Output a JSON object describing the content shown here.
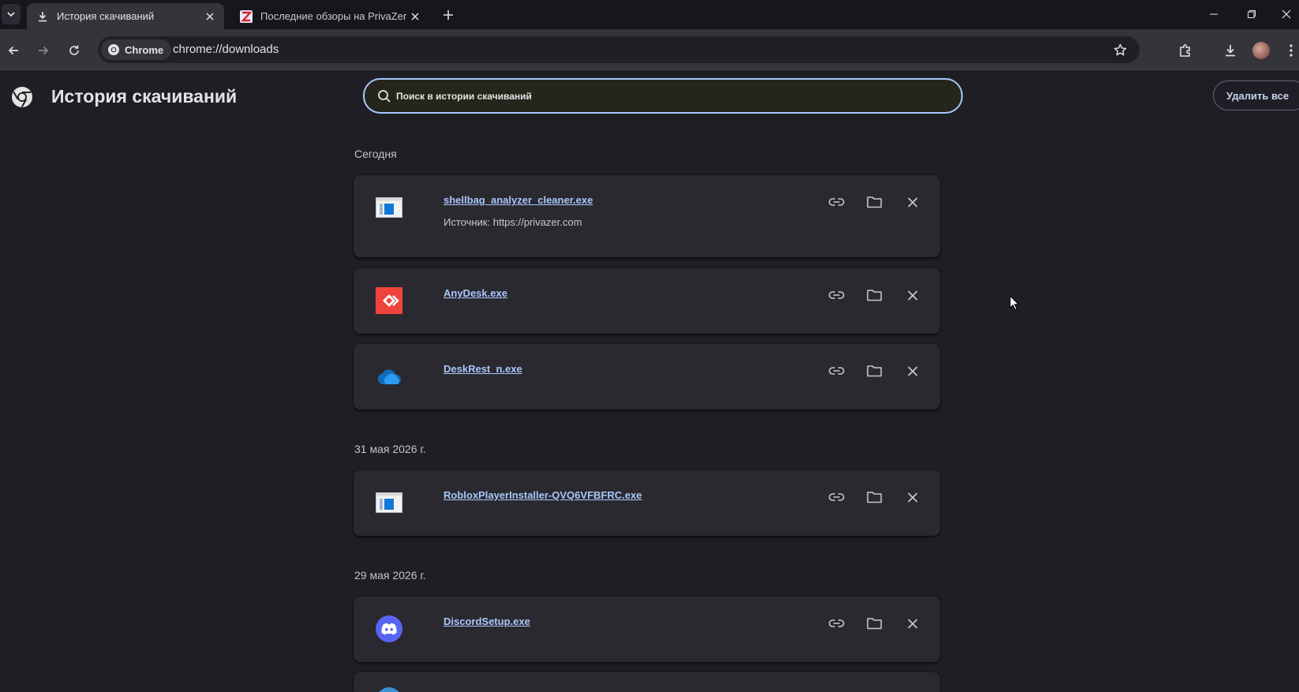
{
  "tabs": [
    {
      "title": "История скачиваний",
      "favicon": "download-icon",
      "active": true
    },
    {
      "title": "Последние обзоры на PrivaZer",
      "favicon": "privazer-icon",
      "active": false
    }
  ],
  "toolbar": {
    "chip_label": "Chrome",
    "url": "chrome://downloads"
  },
  "page": {
    "title": "История скачиваний",
    "search_placeholder": "Поиск в истории скачиваний",
    "clear_all_label": "Удалить все"
  },
  "groups": [
    {
      "date": "Сегодня",
      "items": [
        {
          "name": "shellbag_analyzer_cleaner.exe",
          "source": "Источник: https://privazer.com",
          "icon": "exe-file-icon"
        },
        {
          "name": "AnyDesk.exe",
          "icon": "anydesk-icon"
        },
        {
          "name": "DeskRest_n.exe",
          "icon": "cloud-icon"
        }
      ]
    },
    {
      "date": "31 мая 2026 г.",
      "items": [
        {
          "name": "RobloxPlayerInstaller-QVQ6VFBFRC.exe",
          "icon": "exe-file-icon"
        }
      ]
    },
    {
      "date": "29 мая 2026 г.",
      "items": [
        {
          "name": "DiscordSetup.exe",
          "icon": "discord-icon"
        }
      ]
    }
  ],
  "colors": {
    "background": "#1f1e25",
    "card": "#2a2930",
    "link": "#a8c7fa",
    "search_border": "#a8c7fa"
  }
}
